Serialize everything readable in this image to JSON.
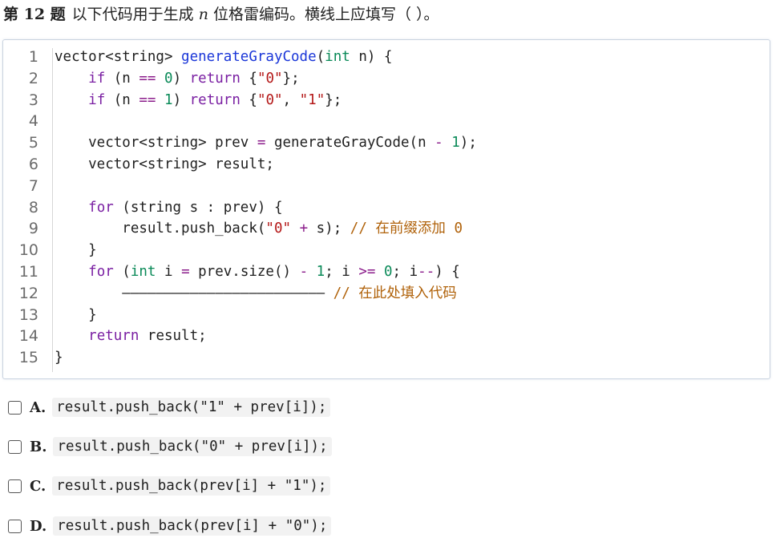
{
  "question": {
    "number_label": "第 12 题",
    "text_before": "以下代码用于生成 ",
    "var": "n",
    "text_after": " 位格雷编码。横线上应填写（ ）。"
  },
  "code": {
    "line_numbers": [
      "1",
      "2",
      "3",
      "4",
      "5",
      "6",
      "7",
      "8",
      "9",
      "10",
      "11",
      "12",
      "13",
      "14",
      "15"
    ],
    "lines": [
      [
        {
          "c": "",
          "t": "vector<string> "
        },
        {
          "c": "f",
          "t": "generateGrayCode"
        },
        {
          "c": "",
          "t": "("
        },
        {
          "c": "t",
          "t": "int"
        },
        {
          "c": "",
          "t": " n) {"
        }
      ],
      [
        {
          "c": "",
          "t": "    "
        },
        {
          "c": "k",
          "t": "if"
        },
        {
          "c": "",
          "t": " (n "
        },
        {
          "c": "o",
          "t": "=="
        },
        {
          "c": "",
          "t": " "
        },
        {
          "c": "n",
          "t": "0"
        },
        {
          "c": "",
          "t": ") "
        },
        {
          "c": "k",
          "t": "return"
        },
        {
          "c": "",
          "t": " {"
        },
        {
          "c": "s",
          "t": "\"0\""
        },
        {
          "c": "",
          "t": "};"
        }
      ],
      [
        {
          "c": "",
          "t": "    "
        },
        {
          "c": "k",
          "t": "if"
        },
        {
          "c": "",
          "t": " (n "
        },
        {
          "c": "o",
          "t": "=="
        },
        {
          "c": "",
          "t": " "
        },
        {
          "c": "n",
          "t": "1"
        },
        {
          "c": "",
          "t": ") "
        },
        {
          "c": "k",
          "t": "return"
        },
        {
          "c": "",
          "t": " {"
        },
        {
          "c": "s",
          "t": "\"0\""
        },
        {
          "c": "",
          "t": ", "
        },
        {
          "c": "s",
          "t": "\"1\""
        },
        {
          "c": "",
          "t": "};"
        }
      ],
      [
        {
          "c": "",
          "t": ""
        }
      ],
      [
        {
          "c": "",
          "t": "    vector<string> prev "
        },
        {
          "c": "o",
          "t": "="
        },
        {
          "c": "",
          "t": " generateGrayCode(n "
        },
        {
          "c": "o",
          "t": "-"
        },
        {
          "c": "",
          "t": " "
        },
        {
          "c": "n",
          "t": "1"
        },
        {
          "c": "",
          "t": ");"
        }
      ],
      [
        {
          "c": "",
          "t": "    vector<string> result;"
        }
      ],
      [
        {
          "c": "",
          "t": ""
        }
      ],
      [
        {
          "c": "",
          "t": "    "
        },
        {
          "c": "k",
          "t": "for"
        },
        {
          "c": "",
          "t": " (string s : prev) {"
        }
      ],
      [
        {
          "c": "",
          "t": "        result.push_back("
        },
        {
          "c": "s",
          "t": "\"0\""
        },
        {
          "c": "",
          "t": " "
        },
        {
          "c": "o",
          "t": "+"
        },
        {
          "c": "",
          "t": " s); "
        },
        {
          "c": "c",
          "t": "// 在前缀添加 0"
        }
      ],
      [
        {
          "c": "",
          "t": "    }"
        }
      ],
      [
        {
          "c": "",
          "t": "    "
        },
        {
          "c": "k",
          "t": "for"
        },
        {
          "c": "",
          "t": " ("
        },
        {
          "c": "t",
          "t": "int"
        },
        {
          "c": "",
          "t": " i "
        },
        {
          "c": "o",
          "t": "="
        },
        {
          "c": "",
          "t": " prev.size() "
        },
        {
          "c": "o",
          "t": "-"
        },
        {
          "c": "",
          "t": " "
        },
        {
          "c": "n",
          "t": "1"
        },
        {
          "c": "",
          "t": "; i "
        },
        {
          "c": "o",
          "t": ">="
        },
        {
          "c": "",
          "t": " "
        },
        {
          "c": "n",
          "t": "0"
        },
        {
          "c": "",
          "t": "; i"
        },
        {
          "c": "o",
          "t": "--"
        },
        {
          "c": "",
          "t": ") {"
        }
      ],
      [
        {
          "c": "",
          "t": "        "
        },
        {
          "c": "blank",
          "t": "———————————————————————— "
        },
        {
          "c": "c",
          "t": "// 在此处填入代码"
        }
      ],
      [
        {
          "c": "",
          "t": "    }"
        }
      ],
      [
        {
          "c": "",
          "t": "    "
        },
        {
          "c": "k",
          "t": "return"
        },
        {
          "c": "",
          "t": " result;"
        }
      ],
      [
        {
          "c": "",
          "t": "}"
        }
      ]
    ]
  },
  "options": [
    {
      "letter": "A.",
      "code": "result.push_back(\"1\" + prev[i]);"
    },
    {
      "letter": "B.",
      "code": "result.push_back(\"0\" + prev[i]);"
    },
    {
      "letter": "C.",
      "code": "result.push_back(prev[i] + \"1\");"
    },
    {
      "letter": "D.",
      "code": "result.push_back(prev[i] + \"0\");"
    }
  ]
}
